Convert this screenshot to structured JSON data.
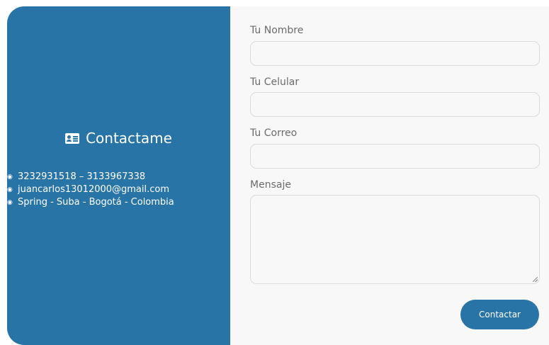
{
  "contact_info": {
    "title": "Contactame",
    "icon": "contact-card-icon",
    "items": [
      {
        "bullet": "◉",
        "text": "3232931518 – 3133967338"
      },
      {
        "bullet": "◉",
        "text": "juancarlos13012000@gmail.com"
      },
      {
        "bullet": "◉",
        "text": "Spring - Suba - Bogotá - Colombia"
      }
    ]
  },
  "form": {
    "name_label": "Tu Nombre",
    "phone_label": "Tu Celular",
    "email_label": "Tu Correo",
    "message_label": "Mensaje",
    "name_value": "",
    "phone_value": "",
    "email_value": "",
    "message_value": "",
    "submit_label": "Contactar"
  },
  "colors": {
    "accent": "#2874a6",
    "form_background": "#f8f8f8",
    "label_text": "#6b6b6b"
  }
}
